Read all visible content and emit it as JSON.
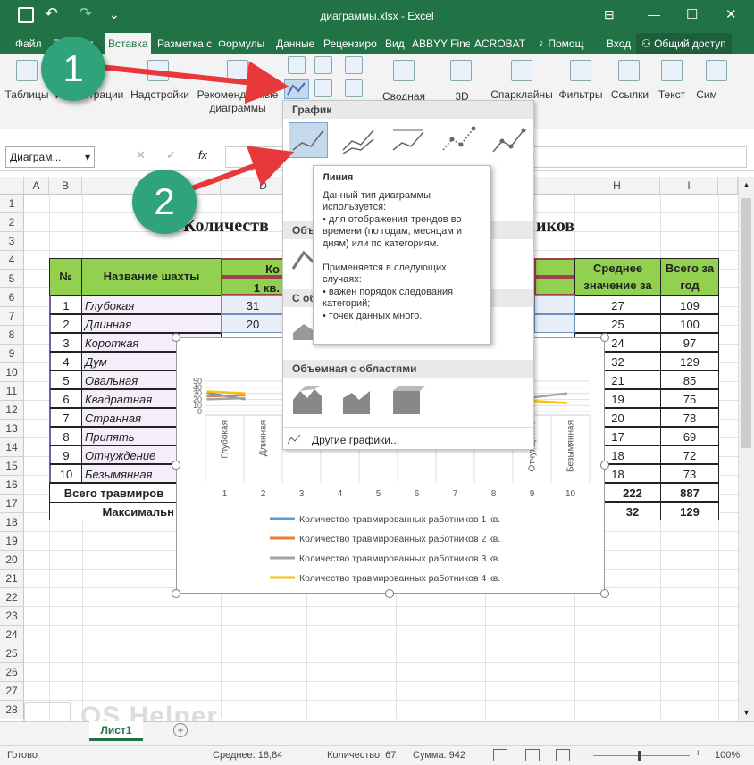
{
  "window": {
    "title": "диаграммы.xlsx - Excel",
    "minimize": "—",
    "maximize": "☐",
    "close": "✕",
    "save_icon": "save-icon",
    "undo": "↶",
    "redo": "↷",
    "customize": "⌄",
    "ribbon_display": "⊟"
  },
  "tabs": [
    "Файл",
    "Главная",
    "Вставка",
    "Разметка с",
    "Формулы",
    "Данные",
    "Рецензиро",
    "Вид",
    "ABBYY Fine",
    "ACROBAT",
    "Помощ",
    "Вход",
    "Общий доступ"
  ],
  "ribbon": {
    "groups": [
      "Таблицы",
      "Иллюстрации",
      "Надстройки",
      "Рекомендуемые диаграммы",
      "Сводная",
      "3D",
      "Спарклайны",
      "Фильтры",
      "Ссылки",
      "Текст",
      "Сим"
    ]
  },
  "formula": {
    "namebox": "Диаграм...",
    "fx": "fx",
    "cancel": "✕",
    "enter": "✓"
  },
  "columns": [
    "A",
    "B",
    "C",
    "D",
    "E",
    "F",
    "G",
    "H",
    "I"
  ],
  "rows": [
    "1",
    "2",
    "3",
    "4",
    "5",
    "6",
    "7",
    "8",
    "9",
    "10",
    "11",
    "12",
    "13",
    "14",
    "15",
    "16",
    "17",
    "18",
    "19",
    "20",
    "21",
    "22",
    "23",
    "24",
    "25",
    "26",
    "27",
    "28"
  ],
  "sheet": {
    "title": "Количеств",
    "title_tail": "иков",
    "hdr_num": "№",
    "hdr_name": "Название шахты",
    "hdr_k": "Ко",
    "hdr_q1": "1 кв.",
    "hdr_avg": "Среднее значение за",
    "hdr_total": "Всего за год",
    "mines": [
      {
        "n": "1",
        "name": "Глубокая",
        "q1": "31",
        "avg": "27",
        "total": "109"
      },
      {
        "n": "2",
        "name": "Длинная",
        "q1": "20",
        "avg": "25",
        "total": "100"
      },
      {
        "n": "3",
        "name": "Короткая",
        "avg": "24",
        "total": "97"
      },
      {
        "n": "4",
        "name": "Дум",
        "avg": "32",
        "total": "129"
      },
      {
        "n": "5",
        "name": "Овальная",
        "avg": "21",
        "total": "85"
      },
      {
        "n": "6",
        "name": "Квадратная",
        "avg": "19",
        "total": "75"
      },
      {
        "n": "7",
        "name": "Странная",
        "avg": "20",
        "total": "78"
      },
      {
        "n": "8",
        "name": "Припять",
        "avg": "17",
        "total": "69"
      },
      {
        "n": "9",
        "name": "Отчуждение",
        "avg": "18",
        "total": "72"
      },
      {
        "n": "10",
        "name": "Безымянная",
        "avg": "18",
        "total": "73"
      }
    ],
    "total_label": "Всего травмиров",
    "total_avg": "222",
    "total_total": "887",
    "max_label": "Максимальн",
    "max_avg": "32",
    "max_total": "129"
  },
  "chart_data": {
    "type": "line",
    "categories": [
      "Глубокая",
      "Длинная",
      "Короткая",
      "Дум",
      "Овальная",
      "Квадратная",
      "Странная",
      "Припять",
      "Отчуждение",
      "Безымянная"
    ],
    "cat_numbers": [
      "1",
      "2",
      "3",
      "4",
      "5",
      "6",
      "7",
      "8",
      "9",
      "10"
    ],
    "cat_visible": [
      "Глубокая",
      "Длинная",
      "Кор",
      "",
      "Ова",
      "Квад",
      "Стр",
      "Пр",
      "Отчуждение",
      "Безымянная"
    ],
    "yticks": [
      "50",
      "40",
      "30",
      "20",
      "10",
      "0"
    ],
    "series": [
      {
        "name": "Количество травмированных работников 1 кв.",
        "color": "#5b9bd5",
        "values": [
          31,
          20
        ]
      },
      {
        "name": "Количество травмированных работников 2 кв.",
        "color": "#ed7d31",
        "values": [
          25,
          27
        ]
      },
      {
        "name": "Количество травмированных работников 3 кв.",
        "color": "#a5a5a5",
        "values": [
          20,
          22
        ]
      },
      {
        "name": "Количество травмированных работников 4 кв.",
        "color": "#ffc000",
        "values": [
          33,
          30
        ]
      }
    ],
    "right_values": {
      "s3": [
        22,
        30
      ],
      "s4": [
        18,
        14
      ]
    }
  },
  "gallery": {
    "h1": "График",
    "h2": "Объ",
    "h3": "С объ",
    "h4": "Объемная с областями",
    "more": "Другие графики..."
  },
  "tooltip": {
    "title": "Линия",
    "l1": "Данный тип диаграммы",
    "l2": "используется:",
    "l3": "• для отображения трендов во",
    "l4": "времени (по годам, месяцам и",
    "l5": "дням) или по категориям.",
    "l6": "Применяется в следующих",
    "l7": "случаях:",
    "l8": "• важен порядок следования",
    "l9": "категорий;",
    "l10": "• точек данных много."
  },
  "callouts": [
    "1",
    "2"
  ],
  "watermark": "OS Helper",
  "sheet_tab": "Лист1",
  "status": {
    "ready": "Готово",
    "avg": "Среднее: 18,84",
    "count": "Количество: 67",
    "sum": "Сумма: 942",
    "zoom": "100%"
  }
}
